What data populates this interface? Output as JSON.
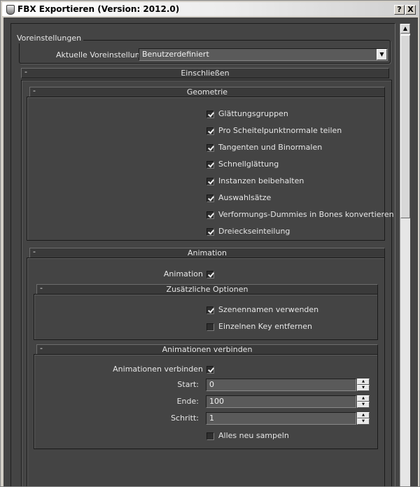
{
  "window": {
    "title": "FBX Exportieren (Version: 2012.0)",
    "help_button": "?",
    "close_button": "X"
  },
  "presets": {
    "group_label": "Voreinstellungen",
    "current_label": "Aktuelle Voreinstellung:",
    "current_value": "Benutzerdefiniert"
  },
  "rollouts": {
    "collapse_glyph": "-",
    "include": {
      "title": "Einschließen"
    },
    "geometry": {
      "title": "Geometrie",
      "options": [
        {
          "label": "Glättungsgruppen",
          "checked": true
        },
        {
          "label": "Pro Scheitelpunktnormale teilen",
          "checked": true
        },
        {
          "label": "Tangenten und Binormalen",
          "checked": true
        },
        {
          "label": "Schnellglättung",
          "checked": true
        },
        {
          "label": "Instanzen beibehalten",
          "checked": true
        },
        {
          "label": "Auswahlsätze",
          "checked": true
        },
        {
          "label": "Verformungs-Dummies in Bones konvertieren",
          "checked": true
        },
        {
          "label": "Dreieckseinteilung",
          "checked": true
        }
      ]
    },
    "animation": {
      "title": "Animation",
      "toggle_label": "Animation",
      "toggle_checked": true,
      "extra": {
        "title": "Zusätzliche Optionen",
        "options": [
          {
            "label": "Szenennamen verwenden",
            "checked": true
          },
          {
            "label": "Einzelnen Key entfernen",
            "checked": false
          }
        ]
      },
      "bake": {
        "title": "Animationen verbinden",
        "toggle_label": "Animationen verbinden",
        "toggle_checked": true,
        "start_label": "Start:",
        "start_value": "0",
        "end_label": "Ende:",
        "end_value": "100",
        "step_label": "Schritt:",
        "step_value": "1",
        "resample_label": "Alles neu sampeln",
        "resample_checked": false
      }
    }
  }
}
